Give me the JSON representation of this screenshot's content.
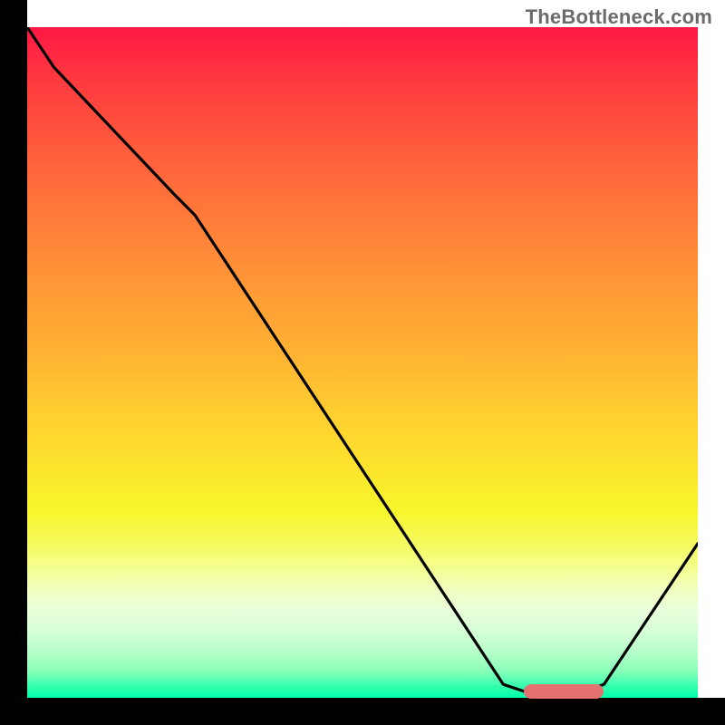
{
  "watermark": "TheBottleneck.com",
  "chart_data": {
    "type": "line",
    "title": "",
    "xlabel": "",
    "ylabel": "",
    "xlim": [
      0,
      100
    ],
    "ylim": [
      0,
      100
    ],
    "grid": false,
    "legend": false,
    "axes_visible": false,
    "background_gradient": {
      "stops": [
        {
          "pos": 0,
          "color": "#ff1744"
        },
        {
          "pos": 50,
          "color": "#ffc02e"
        },
        {
          "pos": 80,
          "color": "#f7ff60"
        },
        {
          "pos": 100,
          "color": "#00ffab"
        }
      ],
      "direction": "top-to-bottom"
    },
    "series": [
      {
        "name": "bottleneck-curve",
        "color": "#000000",
        "x": [
          0,
          4,
          22,
          25,
          71,
          74,
          83,
          86,
          100
        ],
        "y": [
          100,
          94,
          75,
          72,
          2,
          1,
          1,
          2,
          23
        ]
      }
    ],
    "annotations": [
      {
        "name": "optimal-range-marker",
        "type": "hbar",
        "x_start": 74,
        "x_end": 86,
        "y": 1,
        "color": "#e47070"
      }
    ]
  }
}
